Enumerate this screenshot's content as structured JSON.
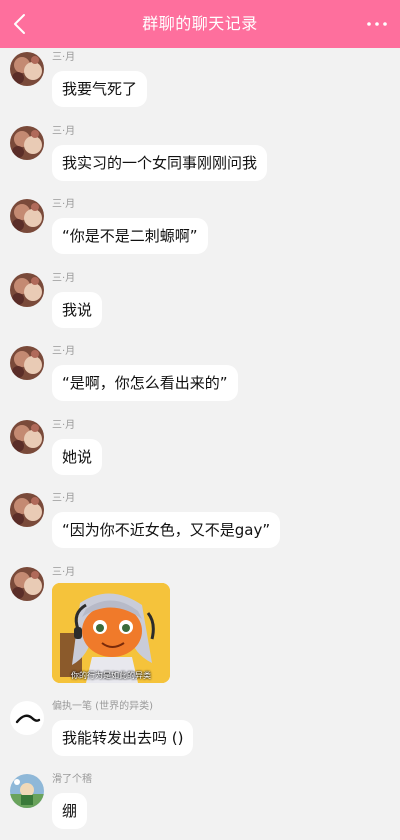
{
  "header": {
    "title": "群聊的聊天记录",
    "back_icon": "chevron-left-icon",
    "more_icon": "more-dots-icon",
    "background": "#fe6f9d"
  },
  "messages": [
    {
      "sender": "三·月",
      "text": "我要气死了"
    },
    {
      "sender": "三·月",
      "text": "我实习的一个女同事刚刚问我"
    },
    {
      "sender": "三·月",
      "text": "“你是不是二刺螈啊”"
    },
    {
      "sender": "三·月",
      "text": "我说"
    },
    {
      "sender": "三·月",
      "text": "“是啊，你怎么看出来的”"
    },
    {
      "sender": "三·月",
      "text": "她说"
    },
    {
      "sender": "三·月",
      "text": "“因为你不近女色，又不是gay”"
    },
    {
      "sender": "三·月",
      "sticker_caption": "你的行为是如此的异类"
    },
    {
      "sender": "偏执一笔 (世界的异类)",
      "text": "我能转发出去吗 ()"
    },
    {
      "sender": "滑了个稽",
      "text": "绷"
    }
  ]
}
